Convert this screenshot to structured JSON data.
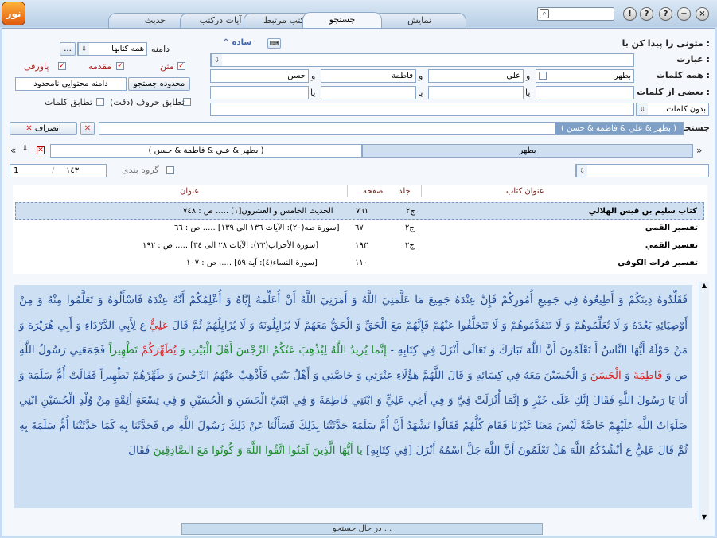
{
  "app": {
    "logo_text": "نور"
  },
  "tabs": [
    {
      "label": "نمایش"
    },
    {
      "label": "جستجو"
    },
    {
      "label": "کتب مرتبط"
    },
    {
      "label": "آیات درکتب"
    },
    {
      "label": "حدیث"
    }
  ],
  "window_buttons": {
    "close": "×",
    "minimize": "−",
    "help": "?",
    "info": "!"
  },
  "form": {
    "find_label": "متونی را پیدا کن با :",
    "phrase_label": "عبارت :",
    "all_words_label": "همه کلمات :",
    "some_words_label": "بعضی از کلمات :",
    "words": [
      "بطهر",
      "علي",
      "فاطمة",
      "حسن"
    ],
    "and": "و",
    "or": "یا",
    "mode_label": "ساده",
    "no_words_label": "بدون کلمات",
    "range_label": "دامنه",
    "range_value": "همه کتابها",
    "range_more": "...",
    "cb_text": "متن",
    "cb_intro": "مقدمه",
    "cb_footnote": "پاورقی",
    "search_range_btn": "محدوده جستجو",
    "content_range_value": "دامنه محتوایی نامحدود",
    "exact_match_label": "تطابق حروف (دقت)",
    "word_match_label": "تطابق کلمات"
  },
  "search": {
    "label": "جستجوی",
    "query": "( بطهر & علي & فاطمة & حسن )",
    "cancel_label": "انصراف"
  },
  "nav": {
    "right_term": "بطهر",
    "left_query": "( بطهر & علي & فاطمة & حسن )",
    "prev": "«",
    "next": "»"
  },
  "grouping": {
    "label": "گروه بندی",
    "page_current": "1",
    "page_total": "١٤٣"
  },
  "table": {
    "headers": {
      "book": "عنوان کتاب",
      "volume": "جلد",
      "page": "صفحه",
      "title": "عنوان"
    },
    "rows": [
      {
        "book": "کتاب سليم بن قيس الهلالي",
        "volume": "ج٢",
        "page": "٧٦١",
        "title": "الحديث الخامس و العشرون[١] ..... ص : ٧٤٨"
      },
      {
        "book": "تفسير القمي",
        "volume": "ج٢",
        "page": "٦٧",
        "title": "[سورة طه(٢٠): الآيات ١٣٦ الى ١٣٩] ..... ص : ٦٦"
      },
      {
        "book": "تفسير القمي",
        "volume": "ج٢",
        "page": "١٩٣",
        "title": "[سورة الأحزاب(٣٣): الآيات ٢٨ الى ٣٤] ..... ص : ١٩٢"
      },
      {
        "book": "تفسير فرات الكوفي",
        "volume": "",
        "page": "١١٠",
        "title": "[سورة النساء(٤): آية ٥٩] ..... ص : ١٠٧"
      }
    ]
  },
  "content": {
    "p1": "فَقَلِّدُوهُ دِينَكُمْ وَ أَطِيعُوهُ فِي جَمِيعِ أُمُورِكُمْ فَإِنَّ عِنْدَهُ جَمِيعَ مَا عَلَّمَنِيَ اللَّهُ وَ أَمَرَنِيَ اللَّهُ أَنْ أُعَلِّمَهُ إِيَّاهُ وَ أُعْلِمُكُمْ أَنَّهُ عِنْدَهُ فَاسْأَلُوهُ وَ تَعَلَّمُوا مِنْهُ وَ مِنْ أَوْصِيَائِهِ بَعْدَهُ وَ لَا تُعَلِّمُوهُمْ وَ لَا تَتَقَدَّمُوهُمْ وَ لَا تَتَخَلَّفُوا عَنْهُمْ فَإِنَّهُمْ مَعَ الْحَقِّ وَ الْحَقُّ مَعَهُمْ لَا يُزَايِلُونَهُ وَ لَا يُزَايِلُهُمْ ثُمَّ قَالَ",
    "h1": "عَلِيٌّ",
    "p2": "ع لِأَبِي الدَّرْدَاءِ وَ أَبِي هُرَيْرَةَ وَ مَنْ حَوْلَهُ أَيُّهَا النَّاسُ أَ تَعْلَمُونَ أَنَّ اللَّهَ تَبَارَكَ وَ تَعَالَى أَنْزَلَ فِي كِتَابِهِ -",
    "q1": "إِنَّما يُرِيدُ اللَّهُ لِيُذْهِبَ عَنْكُمُ الرِّجْسَ أَهْلَ الْبَيْتِ وَ",
    "h2": "يُطَهِّرَكُمْ",
    "q2": "تَطْهِيراً",
    "p3": "فَجَمَعَنِي رَسُولُ اللَّهِ ص وَ",
    "h3": "فَاطِمَةَ",
    "p4": "وَ",
    "h4": "الْحَسَنَ",
    "p5": "وَ الْحُسَيْنَ مَعَهُ فِي كِسَائِهِ وَ قَالَ اللَّهُمَّ هَؤُلَاءِ عِتْرَتِي وَ خَاصَّتِي وَ أَهْلُ بَيْتِي فَأَذْهِبْ عَنْهُمُ الرِّجْسَ وَ طَهِّرْهُمْ تَطْهِيراً فَقَالَتْ أُمُّ سَلَمَةَ وَ أَنَا يَا رَسُولَ اللَّهِ فَقَالَ إِنَّكِ عَلَى خَيْرٍ وَ إِنَّمَا أُنْزِلَتْ فِيَّ وَ فِي أَخِي عَلِيٍّ وَ ابْنَتِي فَاطِمَةَ وَ فِي ابْنَيَّ الْحَسَنِ وَ الْحُسَيْنِ وَ فِي تِسْعَةٍ أَئِمَّةٍ مِنْ وُلْدِ الْحُسَيْنِ ابْنِي صَلَوَاتُ اللَّهِ عَلَيْهِمْ خَاصَّةً لَيْسَ مَعَنَا غَيْرُنَا فَقَامَ كُلُّهُمْ فَقَالُوا نَشْهَدُ أَنَّ أُمَّ سَلَمَةَ حَدَّثَتْنَا بِذَلِكَ فَسَأَلْنَا عَنْ ذَلِكَ رَسُولَ اللَّهِ ص فَحَدَّثَنَا بِهِ كَمَا حَدَّثَتْنَا أُمُّ سَلَمَةَ بِهِ ثُمَّ قَالَ عَلِيٌّ ع أَنْشُدُكُمُ اللَّهَ هَلْ تَعْلَمُونَ أَنَّ اللَّهَ جَلَّ اسْمُهُ أَنْزَلَ [فِي كِتَابِهِ]",
    "q3": "يا أَيُّهَا الَّذِينَ آمَنُوا اتَّقُوا اللَّهَ وَ كُونُوا مَعَ الصَّادِقِينَ",
    "p6": "فَقَالَ"
  },
  "status": {
    "text": "در حال جستجو ..."
  }
}
